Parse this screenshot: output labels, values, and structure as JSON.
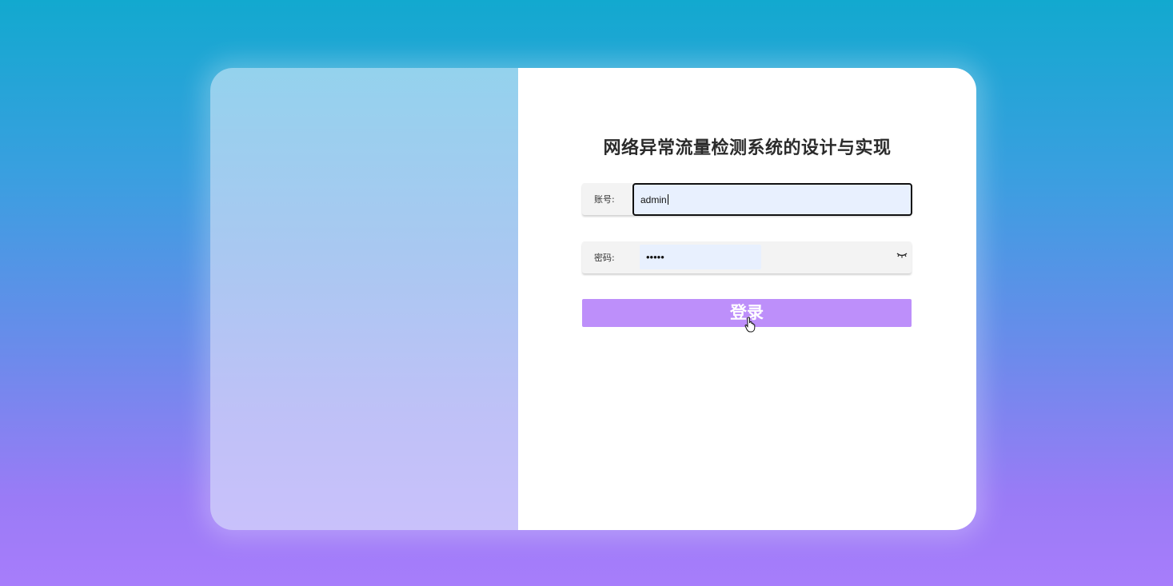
{
  "login": {
    "title": "网络异常流量检测系统的设计与实现",
    "account_label": "账号:",
    "account_value": "admin",
    "password_label": "密码:",
    "password_masked": "•••••",
    "login_button": "登录"
  },
  "icons": {
    "eye": "eye-closed-icon",
    "cursor": "hand-pointer-icon"
  },
  "colors": {
    "button": "#bd8ffa",
    "input_fill": "#e8f0fe",
    "title": "#2b2b2b"
  }
}
